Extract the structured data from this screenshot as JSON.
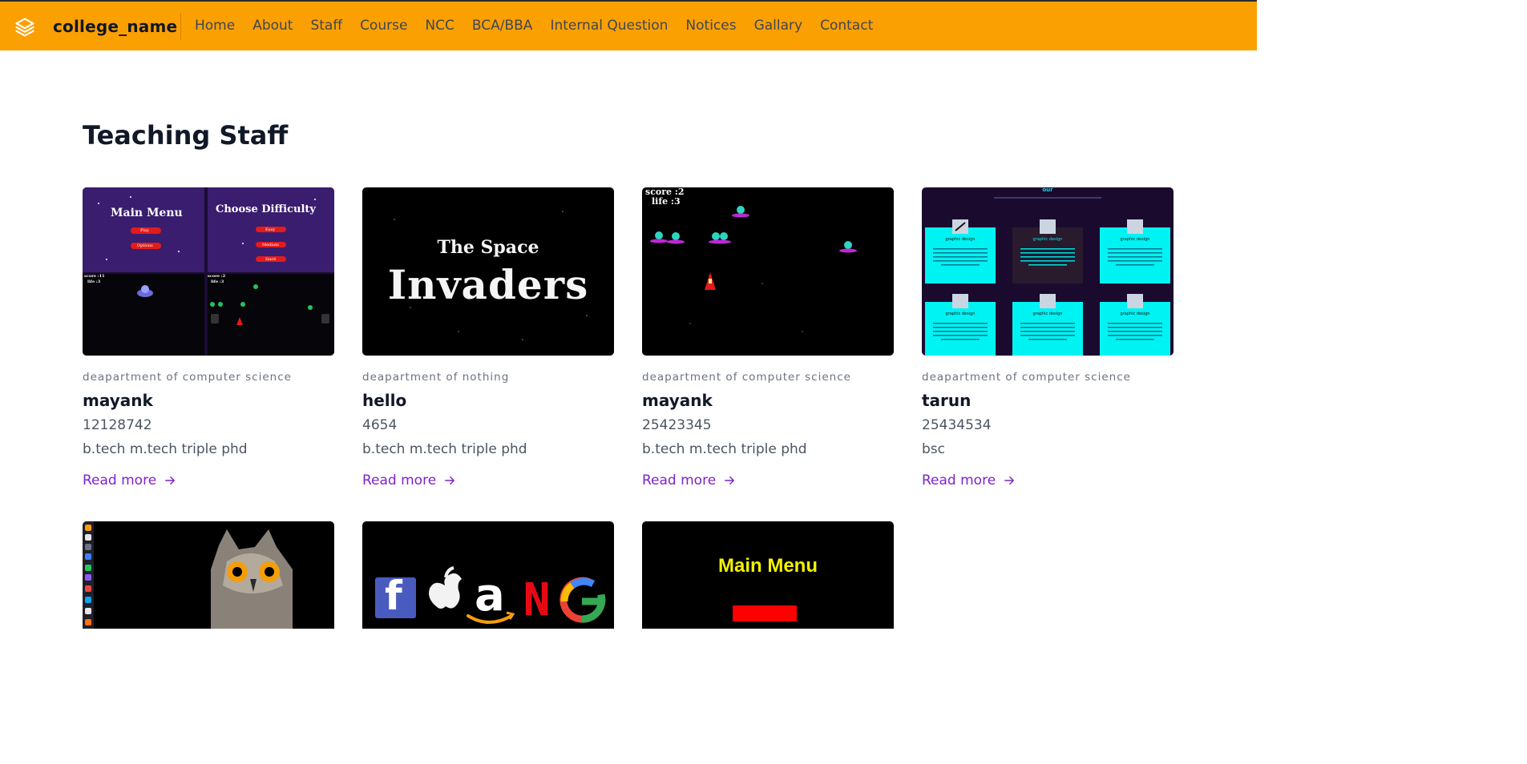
{
  "brand": {
    "name": "college_name",
    "icon": "layers-icon"
  },
  "nav": [
    "Home",
    "About",
    "Staff",
    "Course",
    "NCC",
    "BCA/BBA",
    "Internal Question",
    "Notices",
    "Gallary",
    "Contact"
  ],
  "section": {
    "title": "Teaching Staff"
  },
  "staff": [
    {
      "department": "deapartment of computer science",
      "name": "mayank",
      "phone": "12128742",
      "degree": "b.tech m.tech triple phd",
      "link": "Read more",
      "thumb": {
        "menu_title": "Main Menu",
        "menu_items": [
          "Play",
          "Options"
        ],
        "difficulty_title": "Choose Difficulty",
        "difficulty_items": [
          "Easy",
          "Medium",
          "Hard"
        ],
        "score1": "score :11",
        "life1": "life :3",
        "score2": "score :2",
        "life2": "life :3"
      }
    },
    {
      "department": "deapartment of nothing",
      "name": "hello",
      "phone": "4654",
      "degree": "b.tech m.tech triple phd",
      "link": "Read more",
      "thumb": {
        "line1": "The Space",
        "line2": "Invaders"
      }
    },
    {
      "department": "deapartment of computer science",
      "name": "mayank",
      "phone": "25423345",
      "degree": "b.tech m.tech triple phd",
      "link": "Read more",
      "thumb": {
        "score": "score :2",
        "life": "life :3"
      }
    },
    {
      "department": "deapartment of computer science",
      "name": "tarun",
      "phone": "25434534",
      "degree": "bsc",
      "link": "Read more",
      "thumb": {
        "heading": "our",
        "tile_label": "graphic design"
      }
    }
  ],
  "bottom_thumbs": [
    {
      "kind": "owl-screenshot"
    },
    {
      "kind": "faang-logos",
      "letters": [
        "f",
        "a",
        "N",
        "G"
      ]
    },
    {
      "kind": "game-menu",
      "title": "Main Menu"
    }
  ],
  "colors": {
    "navbar": "#fba003",
    "link": "#7e22ce",
    "cyan_tile": "#00f3f3"
  }
}
